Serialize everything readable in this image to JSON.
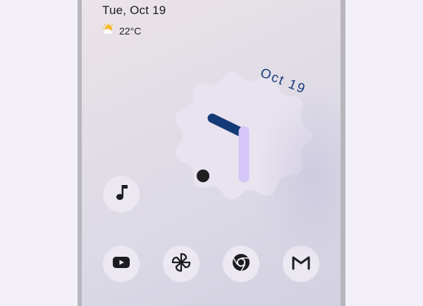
{
  "home_screen": {
    "date": "Tue, Oct 19",
    "weather": {
      "temperature": "22°C",
      "icon": "partly-sunny-icon"
    },
    "clock_widget": {
      "date_label": "Oct 19",
      "icon": "analog-clock",
      "colors": {
        "face": "#e8e3ee",
        "hour_hand": "#143a78",
        "minute_hand": "#d4c7f8",
        "dot": "#1f1f22",
        "date_text": "#143a78"
      }
    },
    "apps": [
      {
        "name": "Music",
        "icon": "music-note-icon"
      }
    ],
    "dock": [
      {
        "name": "YouTube",
        "icon": "youtube-icon"
      },
      {
        "name": "Pinwheel",
        "icon": "pinwheel-icon"
      },
      {
        "name": "Chrome",
        "icon": "chrome-icon"
      },
      {
        "name": "Gmail",
        "icon": "gmail-icon"
      }
    ]
  }
}
